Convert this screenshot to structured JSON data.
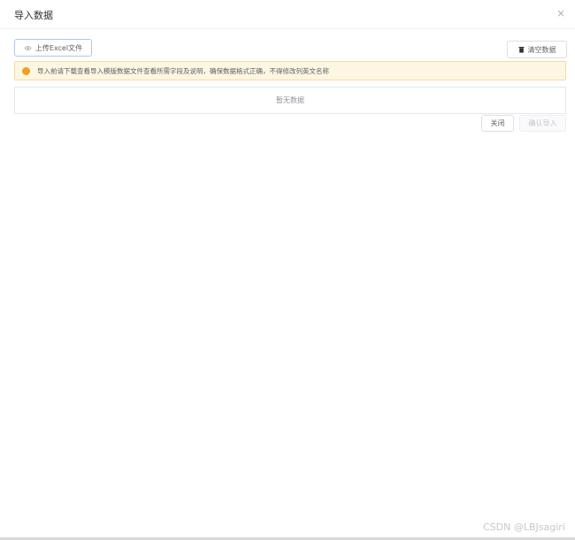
{
  "dialog": {
    "title": "导入数据",
    "close_icon": "×"
  },
  "toolbar": {
    "upload_label": "上传Excel文件",
    "upload_icon": "eye-icon",
    "clear_label": "清空数据",
    "clear_icon": "trash-icon"
  },
  "alert": {
    "text": "导入前请下载查看导入模版数据文件查看所需字段及说明，确保数据格式正确，不得修改列英文名称",
    "color": "#f0a020"
  },
  "table": {
    "empty_text": "暂无数据"
  },
  "footer": {
    "close_label": "关闭",
    "confirm_label": "确认导入"
  },
  "watermark": "CSDN @LBJsagiri"
}
